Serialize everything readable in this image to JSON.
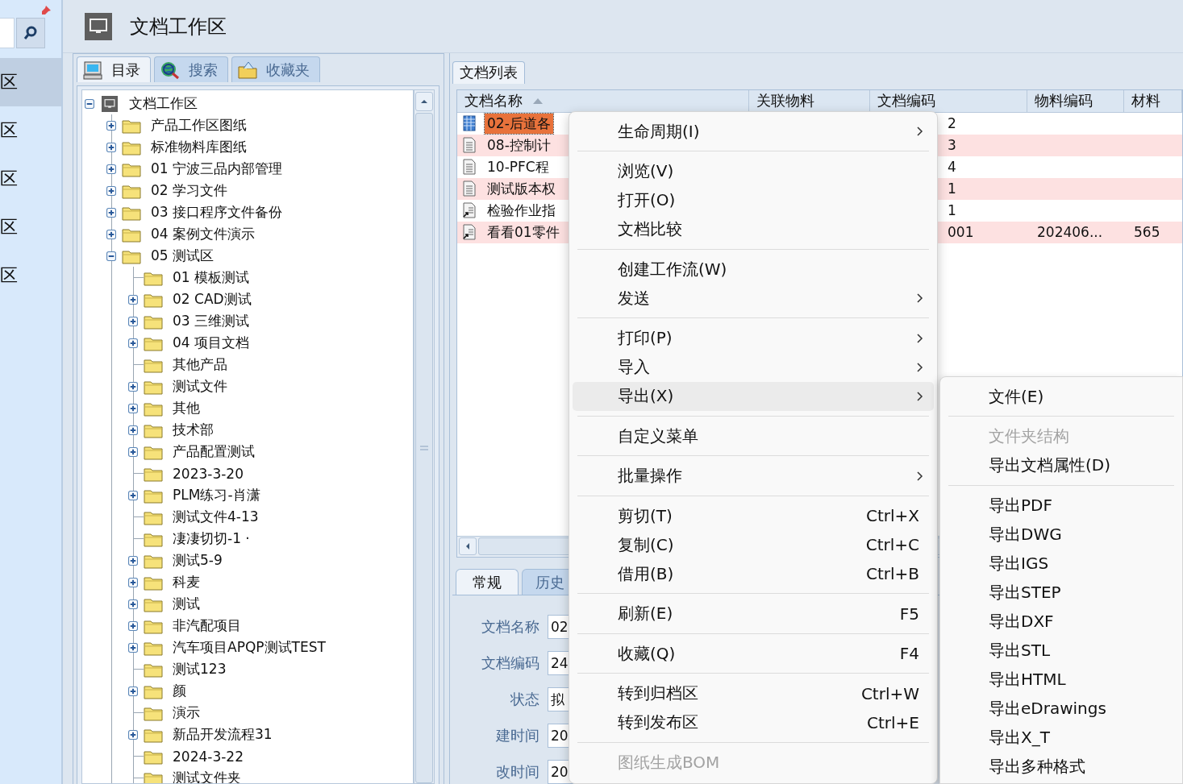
{
  "sidebar": {
    "items": [
      {
        "label": "区",
        "selected": true
      },
      {
        "label": "区",
        "selected": false
      },
      {
        "label": "区",
        "selected": false
      },
      {
        "label": "区",
        "selected": false
      },
      {
        "label": "区",
        "selected": false
      }
    ]
  },
  "workspace": {
    "title": "文档工作区"
  },
  "left_tabs": [
    {
      "label": "目录",
      "selected": true,
      "kind": "catalog"
    },
    {
      "label": "搜索",
      "selected": false,
      "kind": "search"
    },
    {
      "label": "收藏夹",
      "selected": false,
      "kind": "favorites"
    }
  ],
  "tree": {
    "label": "文档工作区",
    "kind": "root",
    "expandable": true,
    "expanded": true,
    "children": [
      {
        "label": "产品工作区图纸",
        "kind": "folder",
        "expandable": true,
        "expanded": false
      },
      {
        "label": "标准物料库图纸",
        "kind": "folder",
        "expandable": true,
        "expanded": false
      },
      {
        "label": "01 宁波三品内部管理",
        "kind": "folder",
        "expandable": true,
        "expanded": false
      },
      {
        "label": "02 学习文件",
        "kind": "folder",
        "expandable": true,
        "expanded": false
      },
      {
        "label": "03 接口程序文件备份",
        "kind": "folder",
        "expandable": true,
        "expanded": false
      },
      {
        "label": "04 案例文件演示",
        "kind": "folder",
        "expandable": true,
        "expanded": false
      },
      {
        "label": "05 测试区",
        "kind": "folder",
        "expandable": true,
        "expanded": true,
        "children": [
          {
            "label": "01 模板测试",
            "kind": "folder",
            "expandable": false
          },
          {
            "label": "02 CAD测试",
            "kind": "folder",
            "expandable": true,
            "expanded": false
          },
          {
            "label": "03 三维测试",
            "kind": "folder",
            "expandable": true,
            "expanded": false
          },
          {
            "label": "04 项目文档",
            "kind": "folder",
            "expandable": true,
            "expanded": false
          },
          {
            "label": "其他产品",
            "kind": "folder",
            "expandable": false
          },
          {
            "label": "测试文件",
            "kind": "folder",
            "expandable": true,
            "expanded": false
          },
          {
            "label": "其他",
            "kind": "folder",
            "expandable": true,
            "expanded": false
          },
          {
            "label": "技术部",
            "kind": "folder",
            "expandable": true,
            "expanded": false
          },
          {
            "label": "产品配置测试",
            "kind": "folder",
            "expandable": true,
            "expanded": false
          },
          {
            "label": "2023-3-20",
            "kind": "folder",
            "expandable": false
          },
          {
            "label": "PLM练习-肖潇",
            "kind": "folder",
            "expandable": true,
            "expanded": false
          },
          {
            "label": "测试文件4-13",
            "kind": "folder",
            "expandable": false
          },
          {
            "label": "凄凄切切-1 ·",
            "kind": "folder",
            "expandable": false
          },
          {
            "label": "测试5-9",
            "kind": "folder",
            "expandable": true,
            "expanded": false
          },
          {
            "label": "科麦",
            "kind": "folder",
            "expandable": true,
            "expanded": false
          },
          {
            "label": "测试",
            "kind": "folder",
            "expandable": true,
            "expanded": false
          },
          {
            "label": "非汽配项目",
            "kind": "folder",
            "expandable": true,
            "expanded": false
          },
          {
            "label": "汽车项目APQP测试TEST",
            "kind": "folder",
            "expandable": true,
            "expanded": false
          },
          {
            "label": "测试123",
            "kind": "folder",
            "expandable": false
          },
          {
            "label": "颜",
            "kind": "folder",
            "expandable": true,
            "expanded": false
          },
          {
            "label": "演示",
            "kind": "folder",
            "expandable": false
          },
          {
            "label": "新品开发流程31",
            "kind": "folder",
            "expandable": true,
            "expanded": false
          },
          {
            "label": "2024-3-22",
            "kind": "folder",
            "expandable": false
          },
          {
            "label": "测试文件夹",
            "kind": "folder",
            "expandable": false
          }
        ]
      }
    ]
  },
  "list_tabs": [
    {
      "label": "文档列表",
      "selected": true
    }
  ],
  "table": {
    "columns": [
      {
        "label": "文档名称",
        "sorted": true
      },
      {
        "label": "关联物料",
        "sorted": false
      },
      {
        "label": "文档编码",
        "sorted": false
      },
      {
        "label": "物料编码",
        "sorted": false
      },
      {
        "label": "材料",
        "sorted": false
      }
    ],
    "rows": [
      {
        "kind": "grid",
        "name": "02-后道各",
        "code": "2",
        "selected": true,
        "color": "#ffffff"
      },
      {
        "kind": "doc",
        "name": "08-控制计",
        "code": "3",
        "selected": false,
        "color": "#fde1e1"
      },
      {
        "kind": "doc",
        "name": "10-PFC程",
        "code": "4",
        "selected": false,
        "color": "#ffffff"
      },
      {
        "kind": "doc",
        "name": "测试版本权",
        "code": "1",
        "selected": false,
        "color": "#fde1e1"
      },
      {
        "kind": "link",
        "name": "检验作业指",
        "code": "1",
        "selected": false,
        "color": "#ffffff"
      },
      {
        "kind": "link",
        "name": "看看01零件",
        "code": "001",
        "material_code": "202406...",
        "material": "565",
        "selected": false,
        "color": "#fde1e1"
      }
    ]
  },
  "detail_tabs": [
    {
      "label": "常规",
      "selected": true
    },
    {
      "label": "历史",
      "selected": false
    }
  ],
  "detail_fields": [
    {
      "label": "文档名称",
      "value": "02"
    },
    {
      "label": "文档编码",
      "value": "24"
    },
    {
      "label": "状态",
      "value": "拟"
    },
    {
      "label": "建时间",
      "value": "20"
    },
    {
      "label": "改时间",
      "value": "20"
    }
  ],
  "context_menu": {
    "items": [
      {
        "kind": "item",
        "label": "生命周期(I)",
        "submenu": true,
        "disabled": false,
        "selected": false
      },
      {
        "kind": "separator"
      },
      {
        "kind": "item",
        "label": "浏览(V)",
        "submenu": false,
        "disabled": false,
        "selected": false
      },
      {
        "kind": "item",
        "label": "打开(O)",
        "submenu": false,
        "disabled": false,
        "selected": false
      },
      {
        "kind": "item",
        "label": "文档比较",
        "submenu": false,
        "disabled": false,
        "selected": false
      },
      {
        "kind": "separator"
      },
      {
        "kind": "item",
        "label": "创建工作流(W)",
        "submenu": false,
        "disabled": false,
        "selected": false
      },
      {
        "kind": "item",
        "label": "发送",
        "submenu": true,
        "disabled": false,
        "selected": false
      },
      {
        "kind": "separator"
      },
      {
        "kind": "item",
        "label": "打印(P)",
        "submenu": true,
        "disabled": false,
        "selected": false
      },
      {
        "kind": "item",
        "label": "导入",
        "submenu": true,
        "disabled": false,
        "selected": false
      },
      {
        "kind": "item",
        "label": "导出(X)",
        "submenu": true,
        "disabled": false,
        "selected": true
      },
      {
        "kind": "separator"
      },
      {
        "kind": "item",
        "label": "自定义菜单",
        "submenu": false,
        "disabled": false,
        "selected": false
      },
      {
        "kind": "separator"
      },
      {
        "kind": "item",
        "label": "批量操作",
        "submenu": true,
        "disabled": false,
        "selected": false
      },
      {
        "kind": "separator"
      },
      {
        "kind": "item",
        "label": "剪切(T)",
        "shortcut": "Ctrl+X",
        "submenu": false,
        "disabled": false,
        "selected": false
      },
      {
        "kind": "item",
        "label": "复制(C)",
        "shortcut": "Ctrl+C",
        "submenu": false,
        "disabled": false,
        "selected": false
      },
      {
        "kind": "item",
        "label": "借用(B)",
        "shortcut": "Ctrl+B",
        "submenu": false,
        "disabled": false,
        "selected": false
      },
      {
        "kind": "separator"
      },
      {
        "kind": "item",
        "label": "刷新(E)",
        "shortcut": "F5",
        "submenu": false,
        "disabled": false,
        "selected": false
      },
      {
        "kind": "separator"
      },
      {
        "kind": "item",
        "label": "收藏(Q)",
        "shortcut": "F4",
        "submenu": false,
        "disabled": false,
        "selected": false
      },
      {
        "kind": "separator"
      },
      {
        "kind": "item",
        "label": "转到归档区",
        "shortcut": "Ctrl+W",
        "submenu": false,
        "disabled": false,
        "selected": false
      },
      {
        "kind": "item",
        "label": "转到发布区",
        "shortcut": "Ctrl+E",
        "submenu": false,
        "disabled": false,
        "selected": false
      },
      {
        "kind": "separator"
      },
      {
        "kind": "item",
        "label": "图纸生成BOM",
        "submenu": false,
        "disabled": true,
        "selected": false
      }
    ]
  },
  "submenu": {
    "items": [
      {
        "kind": "item",
        "label": "文件(E)",
        "disabled": false,
        "selected": false
      },
      {
        "kind": "separator"
      },
      {
        "kind": "item",
        "label": "文件夹结构",
        "disabled": true,
        "selected": false
      },
      {
        "kind": "item",
        "label": "导出文档属性(D)",
        "disabled": false,
        "selected": false
      },
      {
        "kind": "separator"
      },
      {
        "kind": "item",
        "label": "导出PDF",
        "disabled": false,
        "selected": false
      },
      {
        "kind": "item",
        "label": "导出DWG",
        "disabled": false,
        "selected": false
      },
      {
        "kind": "item",
        "label": "导出IGS",
        "disabled": false,
        "selected": false
      },
      {
        "kind": "item",
        "label": "导出STEP",
        "disabled": false,
        "selected": false
      },
      {
        "kind": "item",
        "label": "导出DXF",
        "disabled": false,
        "selected": false
      },
      {
        "kind": "item",
        "label": "导出STL",
        "disabled": false,
        "selected": false
      },
      {
        "kind": "item",
        "label": "导出HTML",
        "disabled": false,
        "selected": false
      },
      {
        "kind": "item",
        "label": "导出eDrawings",
        "disabled": false,
        "selected": false
      },
      {
        "kind": "item",
        "label": "导出X_T",
        "disabled": false,
        "selected": false
      },
      {
        "kind": "item",
        "label": "导出多种格式",
        "disabled": false,
        "selected": false
      }
    ]
  }
}
